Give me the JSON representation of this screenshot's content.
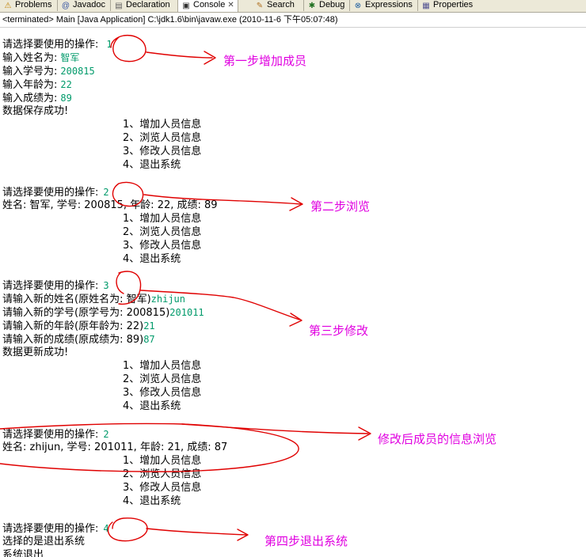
{
  "tabs": [
    {
      "icon": "problems-icon",
      "glyph": "⚠",
      "label": "Problems",
      "active": false
    },
    {
      "icon": "javadoc-icon",
      "glyph": "@",
      "label": "Javadoc",
      "active": false
    },
    {
      "icon": "declaration-icon",
      "glyph": "▤",
      "label": "Declaration",
      "active": false
    },
    {
      "icon": "console-icon",
      "glyph": "▣",
      "label": "Console",
      "active": true
    },
    {
      "icon": "search-icon",
      "glyph": "✎",
      "label": "Search",
      "active": false
    },
    {
      "icon": "debug-icon",
      "glyph": "✱",
      "label": "Debug",
      "active": false
    },
    {
      "icon": "expressions-icon",
      "glyph": "⊗",
      "label": "Expressions",
      "active": false
    },
    {
      "icon": "properties-icon",
      "glyph": "▦",
      "label": "Properties",
      "active": false
    }
  ],
  "console_close_glyph": "✕",
  "status_line": "<terminated> Main [Java Application] C:\\jdk1.6\\bin\\javaw.exe (2010-11-6 下午05:07:48)",
  "menu": [
    "1、增加人员信息",
    "2、浏览人员信息",
    "3、修改人员信息",
    "4、退出系统"
  ],
  "console": {
    "prompt": "请选择要使用的操作:",
    "step1": {
      "choice": "1",
      "name_label": "输入姓名为:",
      "name_value": "智军",
      "id_label": "输入学号为:",
      "id_value": "200815",
      "age_label": "输入年龄为:",
      "age_value": "22",
      "score_label": "输入成绩为:",
      "score_value": "89",
      "result": "数据保存成功!"
    },
    "step2": {
      "choice": "2",
      "record": "姓名: 智军, 学号: 200815, 年龄: 22, 成绩: 89"
    },
    "step3": {
      "choice": "3",
      "name_label": "请输入新的姓名(原姓名为: 智军)",
      "name_value": "zhijun",
      "id_label": "请输入新的学号(原学号为: 200815)",
      "id_value": "201011",
      "age_label": "请输入新的年龄(原年龄为: 22)",
      "age_value": "21",
      "score_label": "请输入新的成绩(原成绩为: 89)",
      "score_value": "87",
      "result": "数据更新成功!"
    },
    "step4": {
      "choice": "2",
      "record": "姓名: zhijun, 学号: 201011, 年龄: 21, 成绩: 87"
    },
    "step5": {
      "choice": "4",
      "line1": "选择的是退出系统",
      "line2": "系统退出"
    }
  },
  "annotations": {
    "step1": "第一步增加成员",
    "step2": "第二步浏览",
    "step3": "第三步修改",
    "step4": "修改后成员的信息浏览",
    "step5": "第四步退出系统"
  },
  "colors": {
    "input": "#009a6a",
    "annotation": "#e000e0",
    "ink": "#e00000"
  }
}
